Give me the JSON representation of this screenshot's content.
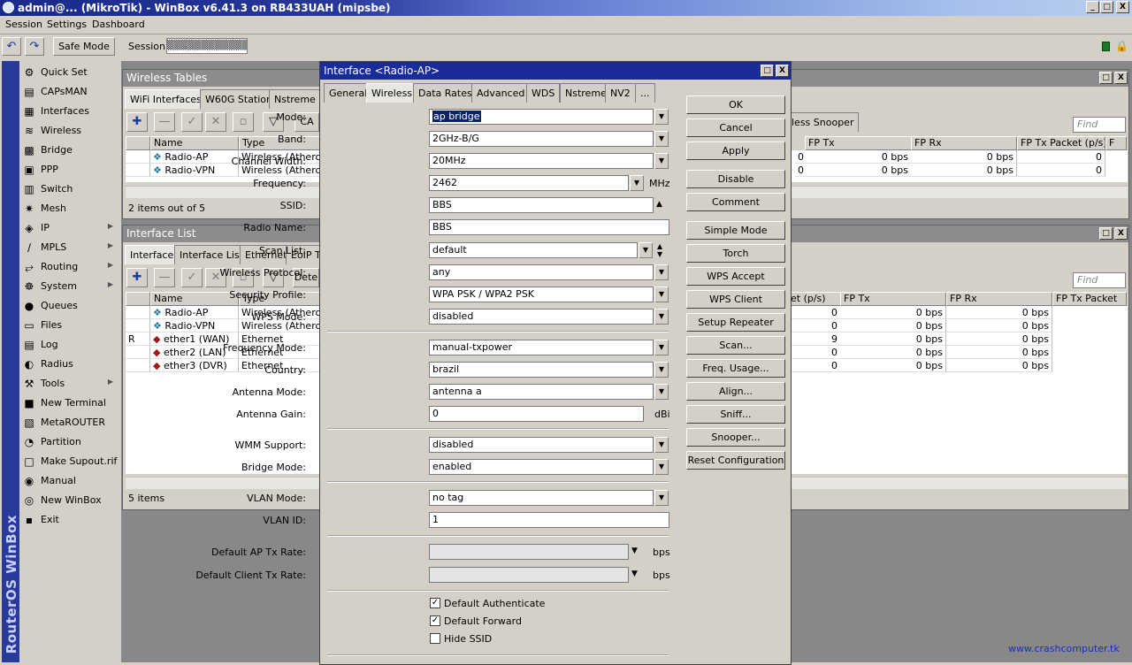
{
  "titlebar": {
    "title": "admin@...  (MikroTik) - WinBox v6.41.3 on RB433UAH (mipsbe)",
    "min": "_",
    "max": "□",
    "close": "X"
  },
  "menubar": {
    "items": [
      "Session",
      "Settings",
      "Dashboard"
    ]
  },
  "toolbar": {
    "undo": "↶",
    "redo": "↷",
    "safe_mode": "Safe Mode",
    "session_label": "Session:",
    "session_value": "▒▒▒▒▒▒▒▒▒▒▒▒"
  },
  "brand_vertical": "RouterOS WinBox",
  "sidebar": {
    "items": [
      {
        "label": "Quick Set",
        "icon": "⚙",
        "arrow": ""
      },
      {
        "label": "CAPsMAN",
        "icon": "▤",
        "arrow": ""
      },
      {
        "label": "Interfaces",
        "icon": "▦",
        "arrow": ""
      },
      {
        "label": "Wireless",
        "icon": "≋",
        "arrow": ""
      },
      {
        "label": "Bridge",
        "icon": "▩",
        "arrow": ""
      },
      {
        "label": "PPP",
        "icon": "▣",
        "arrow": ""
      },
      {
        "label": "Switch",
        "icon": "▥",
        "arrow": ""
      },
      {
        "label": "Mesh",
        "icon": "✷",
        "arrow": ""
      },
      {
        "label": "IP",
        "icon": "◈",
        "arrow": "▶"
      },
      {
        "label": "MPLS",
        "icon": "∕",
        "arrow": "▶"
      },
      {
        "label": "Routing",
        "icon": "⥂",
        "arrow": "▶"
      },
      {
        "label": "System",
        "icon": "☸",
        "arrow": "▶"
      },
      {
        "label": "Queues",
        "icon": "●",
        "arrow": ""
      },
      {
        "label": "Files",
        "icon": "▭",
        "arrow": ""
      },
      {
        "label": "Log",
        "icon": "▤",
        "arrow": ""
      },
      {
        "label": "Radius",
        "icon": "◐",
        "arrow": ""
      },
      {
        "label": "Tools",
        "icon": "⚒",
        "arrow": "▶"
      },
      {
        "label": "New Terminal",
        "icon": "■",
        "arrow": ""
      },
      {
        "label": "MetaROUTER",
        "icon": "▧",
        "arrow": ""
      },
      {
        "label": "Partition",
        "icon": "◔",
        "arrow": ""
      },
      {
        "label": "Make Supout.rif",
        "icon": "□",
        "arrow": ""
      },
      {
        "label": "Manual",
        "icon": "◉",
        "arrow": ""
      },
      {
        "label": "New WinBox",
        "icon": "◎",
        "arrow": ""
      },
      {
        "label": "Exit",
        "icon": "▪",
        "arrow": ""
      }
    ]
  },
  "wireless_tables": {
    "title": "Wireless Tables",
    "tabs": [
      "WiFi Interfaces",
      "W60G Station",
      "Nstreme D"
    ],
    "snooper_tab": "less Snooper",
    "find_placeholder": "Find",
    "ca_btn": "CA",
    "left_cols": [
      "Name",
      "Type"
    ],
    "right_cols": [
      "FP Tx",
      "FP Rx",
      "FP Tx Packet (p/s)",
      "F"
    ],
    "rows": [
      {
        "name": "Radio-AP",
        "type": "Wireless (Atheros A",
        "fptx": "0",
        "fprx_tx": "0 bps",
        "fprx": "0 bps",
        "pkt": "0"
      },
      {
        "name": "Radio-VPN",
        "type": "Wireless (Atheros A",
        "fptx": "0",
        "fprx_tx": "0 bps",
        "fprx": "0 bps",
        "pkt": "0"
      }
    ],
    "status": "2 items out of 5"
  },
  "interface_list": {
    "title": "Interface List",
    "tabs": [
      "Interface",
      "Interface List",
      "Ethernet",
      "EoIP T"
    ],
    "dete_btn": "Dete",
    "find_placeholder": "Find",
    "left_cols": [
      "Name",
      "Type"
    ],
    "right_cols": [
      "et (p/s)",
      "FP Tx",
      "FP Rx",
      "FP Tx Packet"
    ],
    "rows": [
      {
        "flag": "",
        "name": "Radio-AP",
        "type": "Wireless (Atheros A",
        "pps": "0",
        "fptx": "0 bps",
        "fprx": "0 bps"
      },
      {
        "flag": "",
        "name": "Radio-VPN",
        "type": "Wireless (Atheros A",
        "pps": "0",
        "fptx": "0 bps",
        "fprx": "0 bps"
      },
      {
        "flag": "R",
        "name": "ether1 (WAN)",
        "type": "Ethernet",
        "pps": "9",
        "fptx": "0 bps",
        "fprx": "0 bps"
      },
      {
        "flag": "",
        "name": "ether2 (LAN)",
        "type": "Ethernet",
        "pps": "0",
        "fptx": "0 bps",
        "fprx": "0 bps"
      },
      {
        "flag": "",
        "name": "ether3 (DVR)",
        "type": "Ethernet",
        "pps": "0",
        "fptx": "0 bps",
        "fprx": "0 bps"
      }
    ],
    "status": "5 items"
  },
  "dialog": {
    "title": "Interface <Radio-AP>",
    "tabs": [
      "General",
      "Wireless",
      "Data Rates",
      "Advanced",
      "WDS",
      "Nstreme",
      "NV2",
      "..."
    ],
    "fields": {
      "mode": {
        "label": "Mode:",
        "value": "ap bridge"
      },
      "band": {
        "label": "Band:",
        "value": "2GHz-B/G"
      },
      "channel_width": {
        "label": "Channel Width:",
        "value": "20MHz"
      },
      "frequency": {
        "label": "Frequency:",
        "value": "2462",
        "unit": "MHz"
      },
      "ssid": {
        "label": "SSID:",
        "value": "BBS"
      },
      "radio_name": {
        "label": "Radio Name:",
        "value": "BBS"
      },
      "scan_list": {
        "label": "Scan List:",
        "value": "default"
      },
      "wireless_protocol": {
        "label": "Wireless Protocol:",
        "value": "any"
      },
      "security_profile": {
        "label": "Security Profile:",
        "value": "WPA PSK / WPA2 PSK"
      },
      "wps_mode": {
        "label": "WPS Mode:",
        "value": "disabled"
      },
      "frequency_mode": {
        "label": "Frequency Mode:",
        "value": "manual-txpower"
      },
      "country": {
        "label": "Country:",
        "value": "brazil"
      },
      "antenna_mode": {
        "label": "Antenna Mode:",
        "value": "antenna a"
      },
      "antenna_gain": {
        "label": "Antenna Gain:",
        "value": "0",
        "unit": "dBi"
      },
      "wmm_support": {
        "label": "WMM Support:",
        "value": "disabled"
      },
      "bridge_mode": {
        "label": "Bridge Mode:",
        "value": "enabled"
      },
      "vlan_mode": {
        "label": "VLAN Mode:",
        "value": "no tag"
      },
      "vlan_id": {
        "label": "VLAN ID:",
        "value": "1"
      },
      "default_ap_tx_rate": {
        "label": "Default AP Tx Rate:",
        "value": "",
        "unit": "bps"
      },
      "default_client_tx_rate": {
        "label": "Default Client Tx Rate:",
        "value": "",
        "unit": "bps"
      }
    },
    "checkboxes": [
      {
        "label": "Default Authenticate",
        "checked": true,
        "mark": "✓"
      },
      {
        "label": "Default Forward",
        "checked": true,
        "mark": "✓"
      },
      {
        "label": "Hide SSID",
        "checked": false,
        "mark": ""
      }
    ],
    "buttons": [
      "OK",
      "Cancel",
      "Apply",
      "Disable",
      "Comment",
      "Simple Mode",
      "Torch",
      "WPS Accept",
      "WPS Client",
      "Setup Repeater",
      "Scan...",
      "Freq. Usage...",
      "Align...",
      "Sniff...",
      "Snooper...",
      "Reset Configuration"
    ]
  },
  "watermark": "www.crashcomputer.tk",
  "colors": {
    "titlebar": "#1a2b9a",
    "workspace": "#888888",
    "selection": "#0a246a",
    "watermark": "#1a2bc8"
  }
}
